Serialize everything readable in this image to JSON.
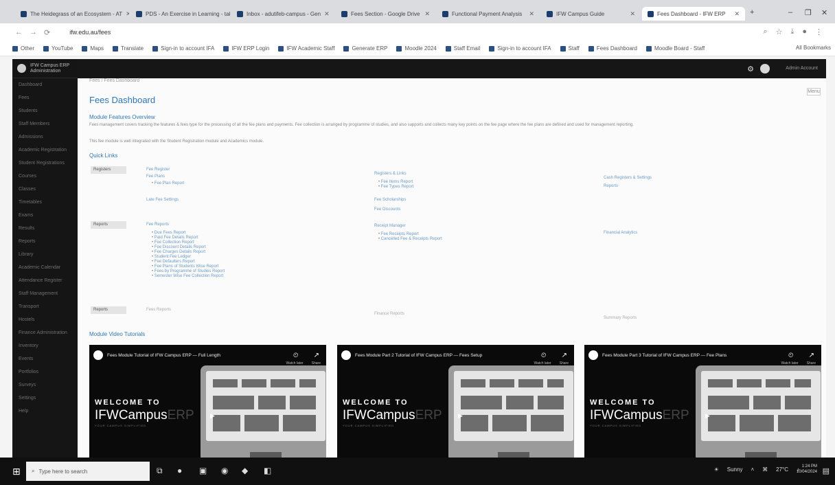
{
  "browser": {
    "tabs": [
      {
        "label": "The Heidegrass of an Ecosystem - AT"
      },
      {
        "label": "PDS - An Exercise in Learning - take an"
      },
      {
        "label": "Inbox - adutifeb-campus - Gen"
      },
      {
        "label": "Fees Section - Google Drive"
      },
      {
        "label": "Functional Payment Analysis"
      },
      {
        "label": "IFW Campus Guide"
      },
      {
        "label": "Fees Dashboard - IFW ERP",
        "active": true
      }
    ],
    "window_controls": {
      "minimize": "–",
      "restore": "❐",
      "close": "✕"
    },
    "url": "ifw.edu.au/fees",
    "bookmarks": [
      "Other",
      "YouTube",
      "Maps",
      "Translate",
      "Sign-in to account IFA",
      "IFW ERP Login",
      "IFW Academic Staff",
      "Generate ERP",
      "Moodle 2024",
      "Staff Email",
      "Sign-in to account IFA",
      "Staff",
      "Fees Dashboard",
      "Moodle Board - Staff"
    ],
    "bookmarks_right": "All Bookmarks"
  },
  "app": {
    "brand": [
      "IFW Campus ERP",
      "Administration"
    ],
    "sidebar_items": [
      "Dashboard",
      "Fees",
      "Students",
      "Staff Members",
      "Admissions",
      "Academic Registration",
      "Student Registrations",
      "Courses",
      "Classes",
      "Timetables",
      "Exams",
      "Results",
      "Reports",
      "Library",
      "Academic Calendar",
      "Attendance Register",
      "Staff Management",
      "Transport",
      "Hostels",
      "Finance Administration",
      "Inventory",
      "Events",
      "Portfolios",
      "Surveys",
      "Settings",
      "Help"
    ],
    "user_name": "Admin Account"
  },
  "main": {
    "breadcrumb": "Fees / Fees Dashboard",
    "page_title": "Fees Dashboard",
    "menu_label": "Menu",
    "overview_title": "Module Features Overview",
    "intro_1": "Fees management covers tracking the features & fees type for the processing of all the fee plans and payments. Fee collection is arranged by programme of studies, and also supports and collects many key points on the fee page where the fee plans are defined and used for management reporting.",
    "intro_2": "This fee module is well integrated with the Student Registration module and Academics module.",
    "quick_links_title": "Quick Links",
    "rows": [
      {
        "label": "Registers",
        "col1": [
          "Fee Register",
          "Fee Plans"
        ],
        "col1_bullets": [
          "Fee Plan Report"
        ],
        "col1_extra": "Late Fee Settings",
        "col2_title": "Registers & Links",
        "col2_bullets": [
          "Fee Items Report",
          "Fee Types Report"
        ],
        "col2_extra": [
          "Fee Scholarships",
          "Fee Discounts"
        ],
        "col3_title": "Cash Registers & Settings",
        "col3_extra": "Reports"
      },
      {
        "label": "Reports",
        "col1_title": "Fee Reports",
        "col1_bullets": [
          "Due Fees Report",
          "Paid Fee Details Report",
          "Fee Collection Report",
          "Fee Discount Details Report",
          "Fee Charges Details Report",
          "Student Fee Ledger",
          "Fee Defaulters Report",
          "Fee Plans of Students Wise Report",
          "Fees by Programme of Studies Report",
          "Semester Wise Fee Collection Report"
        ],
        "col2_title": "Receipt Manager",
        "col2_bullets": [
          "Fee Receipts Report",
          "Cancelled Fee & Receipts Report"
        ],
        "col3_title": "Financial Analytics"
      },
      {
        "label": "Reports",
        "col1": "Fees Reports",
        "col2": "Finance Reports",
        "col3": "Summary Reports"
      }
    ],
    "videos_title": "Module Video Tutorials",
    "videos": [
      {
        "title": "Fees Module Tutorial of IFW Campus ERP — Full Length",
        "sub": [
          "Watch later",
          "Share"
        ],
        "welcome": "WELCOME TO",
        "brand": "IFWCampus",
        "brand_ext": "ERP",
        "tag": "YOUR CAMPUS SIMPLIFIED"
      },
      {
        "title": "Fees Module Part 2 Tutorial of IFW Campus ERP — Fees Setup",
        "sub": [
          "Watch later",
          "Share"
        ],
        "welcome": "WELCOME TO",
        "brand": "IFWCampus",
        "brand_ext": "ERP",
        "tag": "YOUR CAMPUS SIMPLIFIED"
      },
      {
        "title": "Fees Module Part 3 Tutorial of IFW Campus ERP — Fee Plans",
        "sub": [
          "Watch later",
          "Share"
        ],
        "welcome": "WELCOME TO",
        "brand": "IFWCampus",
        "brand_ext": "ERP",
        "tag": "YOUR CAMPUS SIMPLIFIED"
      }
    ]
  },
  "taskbar": {
    "search_placeholder": "Type here to search",
    "weather": "Sunny",
    "tray_temp": "27°C",
    "time": "1:24 PM",
    "date": "10/04/2024"
  }
}
